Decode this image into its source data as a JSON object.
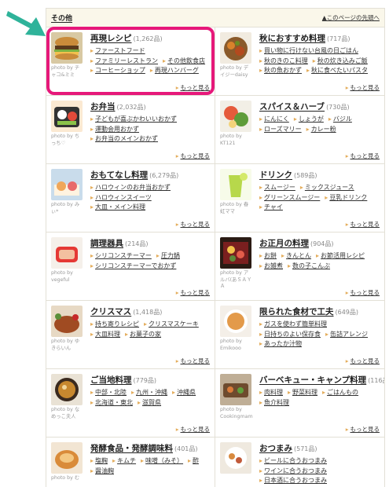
{
  "header": {
    "title": "その他",
    "top_link": "▲このページの先頭へ"
  },
  "more_label": "もっと見る",
  "accent_colors": {
    "highlight": "#e6187a",
    "arrow": "#2fb39a",
    "bullet": "#e4ad5c"
  },
  "categories": [
    {
      "title": "再現レシピ",
      "count": "(1,262品)",
      "credit": "photo by チャコ&ミミ",
      "thumb": "burger",
      "links": [
        "ファーストフード",
        "ファミリーレストラン",
        "その他飲食店",
        "コーヒーショップ",
        "再現ハンバーグ"
      ]
    },
    {
      "title": "秋におすすめ料理",
      "count": "(717品)",
      "credit": "photo by デイジーdaisy",
      "thumb": "autumn",
      "links": [
        "買い物に行けない台風の日ごはん",
        "秋のきのこ料理",
        "秋の炊き込みご飯",
        "秋の魚おかず",
        "秋に食べたいパスタ"
      ]
    },
    {
      "title": "お弁当",
      "count": "(2,032品)",
      "credit": "photo by ちっち♡",
      "thumb": "bento",
      "links": [
        "子どもが喜ぶかわいいおかず",
        "運動会用おかず",
        "お弁当のメインおかず"
      ]
    },
    {
      "title": "スパイス＆ハーブ",
      "count": "(730品)",
      "credit": "photo by KT121",
      "thumb": "spice",
      "links": [
        "にんにく",
        "しょうが",
        "バジル",
        "ローズマリー",
        "カレー粉"
      ]
    },
    {
      "title": "おもてなし料理",
      "count": "(6,279品)",
      "credit": "photo by みぃ*",
      "thumb": "party",
      "links": [
        "ハロウィンのお弁当おかず",
        "ハロウィンスイーツ",
        "大皿・メイン料理"
      ]
    },
    {
      "title": "ドリンク",
      "count": "(589品)",
      "credit": "photo by 春虹ママ",
      "thumb": "drink",
      "links": [
        "スムージー",
        "ミックスジュース",
        "グリーンスムージー",
        "豆乳ドリンク",
        "チャイ"
      ]
    },
    {
      "title": "調理器具",
      "count": "(214品)",
      "credit": "photo by vegeful",
      "thumb": "cookware",
      "links": [
        "シリコンスチーマー",
        "圧力鍋",
        "シリコンスチーマーでおかず"
      ]
    },
    {
      "title": "お正月の料理",
      "count": "(904品)",
      "credit": "photo by アルバ(あＳＡＹＡ",
      "thumb": "newyear",
      "links": [
        "お餅",
        "きんとん",
        "お節活用レシピ",
        "お雑煮",
        "数の子こんぶ"
      ]
    },
    {
      "title": "クリスマス",
      "count": "(1,418品)",
      "credit": "photo by ゆきらいん",
      "thumb": "christmas",
      "links": [
        "持ち寄りレシピ",
        "クリスマスケーキ",
        "大皿料理",
        "お菓子の家"
      ]
    },
    {
      "title": "限られた食材で工夫",
      "count": "(649品)",
      "credit": "photo by Emikooo",
      "thumb": "limited",
      "links": [
        "ガスを使わず簡単料理",
        "日持ちのよい保存食",
        "缶詰アレンジ",
        "あったか汁物"
      ]
    },
    {
      "title": "ご当地料理",
      "count": "(779品)",
      "credit": "photo by なめっこ夫人",
      "thumb": "local",
      "links": [
        "中部・北陸",
        "九州・沖縄",
        "沖縄県",
        "北海道・東北",
        "滋賀県"
      ]
    },
    {
      "title": "バーベキュー・キャンプ料理",
      "count": "(116品)",
      "credit": "photo by Cookingmam",
      "thumb": "bbq",
      "links": [
        "肉料理",
        "野菜料理",
        "ごはんもの",
        "魚介料理"
      ]
    },
    {
      "title": "発酵食品・発酵調味料",
      "count": "(401品)",
      "credit": "photo by む",
      "thumb": "ferment",
      "links": [
        "塩麹",
        "キムチ",
        "味噌（みそ）",
        "酢",
        "醤油麹"
      ]
    },
    {
      "title": "おつまみ",
      "count": "(571品)",
      "credit": "",
      "thumb": "snack",
      "links": [
        "ビールに合うおつまみ",
        "ワインに合うおつまみ",
        "日本酒に合うおつまみ"
      ]
    }
  ]
}
